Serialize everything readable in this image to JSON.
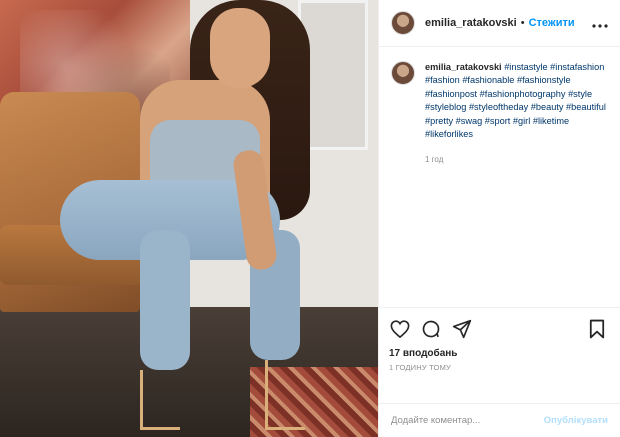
{
  "header": {
    "username": "emilia_ratakovski",
    "separator": "•",
    "follow_label": "Стежити",
    "more_icon": "more-options-icon"
  },
  "caption": {
    "username": "emilia_ratakovski",
    "hashtags": [
      "#instastyle",
      "#instafashion",
      "#fashion",
      "#fashionable",
      "#fashionstyle",
      "#fashionpost",
      "#fashionphotography",
      "#style",
      "#styleblog",
      "#styleoftheday",
      "#beauty",
      "#beautiful",
      "#pretty",
      "#swag",
      "#sport",
      "#girl",
      "#liketime",
      "#likeforlikes"
    ],
    "time": "1 год"
  },
  "actions": {
    "like_icon": "heart-icon",
    "comment_icon": "comment-icon",
    "share_icon": "share-icon",
    "save_icon": "bookmark-icon",
    "likes": "17 вподобань",
    "ago": "1 ГОДИНУ ТОМУ"
  },
  "comment_box": {
    "placeholder": "Додайте коментар...",
    "publish_label": "Опублікувати"
  },
  "colors": {
    "accent": "#0095f6",
    "hashtag": "#00376b",
    "muted": "#8e8e8e",
    "publish_disabled": "#b2dffc"
  }
}
